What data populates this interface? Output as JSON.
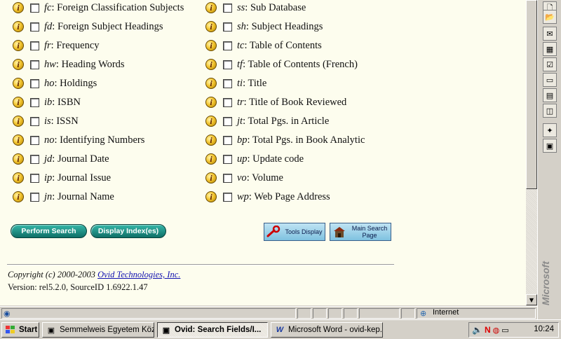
{
  "fields_left": [
    {
      "code": "fc",
      "label": "Foreign Classification Subjects"
    },
    {
      "code": "fd",
      "label": "Foreign Subject Headings"
    },
    {
      "code": "fr",
      "label": "Frequency"
    },
    {
      "code": "hw",
      "label": "Heading Words"
    },
    {
      "code": "ho",
      "label": "Holdings"
    },
    {
      "code": "ib",
      "label": "ISBN"
    },
    {
      "code": "is",
      "label": "ISSN"
    },
    {
      "code": "no",
      "label": "Identifying Numbers"
    },
    {
      "code": "jd",
      "label": "Journal Date"
    },
    {
      "code": "ip",
      "label": "Journal Issue"
    },
    {
      "code": "jn",
      "label": "Journal Name"
    }
  ],
  "fields_right": [
    {
      "code": "ss",
      "label": "Sub Database"
    },
    {
      "code": "sh",
      "label": "Subject Headings"
    },
    {
      "code": "tc",
      "label": "Table of Contents"
    },
    {
      "code": "tf",
      "label": "Table of Contents (French)"
    },
    {
      "code": "ti",
      "label": "Title"
    },
    {
      "code": "tr",
      "label": "Title of Book Reviewed"
    },
    {
      "code": "jt",
      "label": "Total Pgs. in Article"
    },
    {
      "code": "bp",
      "label": "Total Pgs. in Book Analytic"
    },
    {
      "code": "up",
      "label": "Update code"
    },
    {
      "code": "vo",
      "label": "Volume"
    },
    {
      "code": "wp",
      "label": "Web Page Address"
    }
  ],
  "info_glyph": "i",
  "separator": ": ",
  "buttons": {
    "perform_search": "Perform Search",
    "display_indexes": "Display Index(es)",
    "tools_display": "Tools Display",
    "main_search_page": "Main Search Page"
  },
  "footer": {
    "copyright_prefix": "Copyright (c) 2000-2003 ",
    "company_link": "Ovid Technologies, Inc.",
    "version": "Version: rel5.2.0, SourceID 1.6922.1.47"
  },
  "statusbar": {
    "zone": "Internet"
  },
  "office_bar": {
    "brand": "Microsoft"
  },
  "taskbar": {
    "start": "Start",
    "tasks": [
      {
        "label": "Semmelweis Egyetem Köz...",
        "active": false
      },
      {
        "label": "Ovid: Search Fields/I...",
        "active": true
      },
      {
        "label": "Microsoft Word - ovid-kep...",
        "active": false
      }
    ],
    "clock": "10:24"
  },
  "colors": {
    "page_bg": "#fdfdee",
    "button_teal": "#1a8c80",
    "link_blue": "#1010b0"
  }
}
